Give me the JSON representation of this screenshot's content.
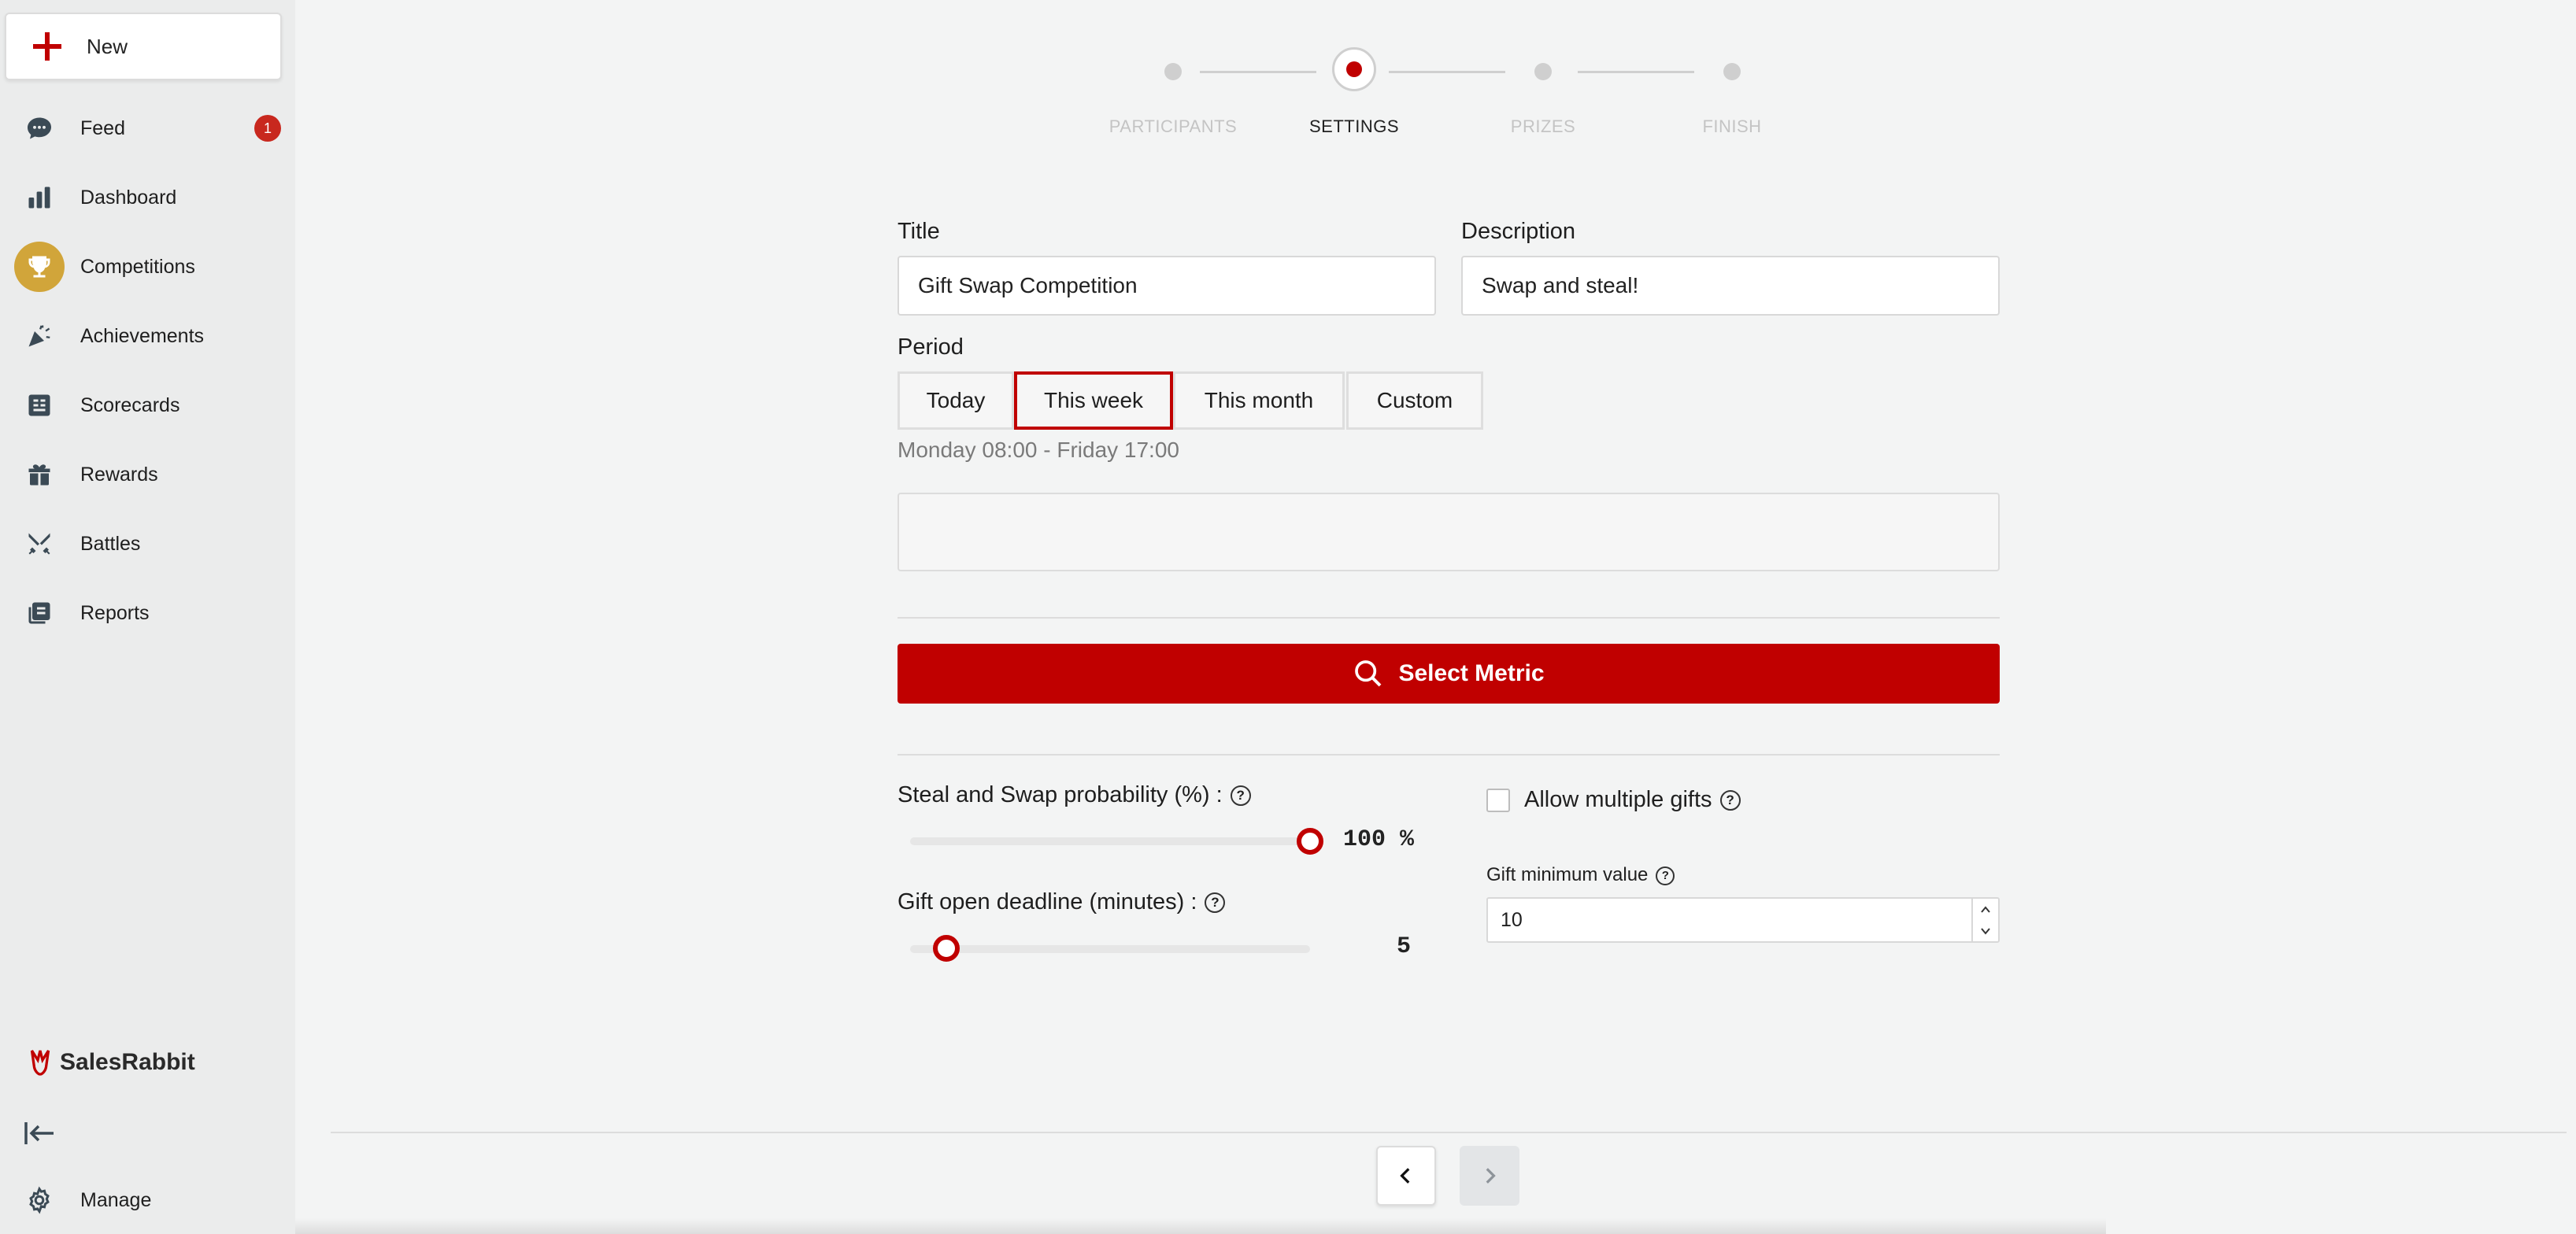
{
  "sidebar": {
    "new_label": "New",
    "items": [
      {
        "label": "Feed",
        "icon": "chat-icon",
        "badge": "1"
      },
      {
        "label": "Dashboard",
        "icon": "bar-chart-icon"
      },
      {
        "label": "Competitions",
        "icon": "trophy-icon",
        "active": true
      },
      {
        "label": "Achievements",
        "icon": "party-popper-icon"
      },
      {
        "label": "Scorecards",
        "icon": "scorecard-icon"
      },
      {
        "label": "Rewards",
        "icon": "gift-icon"
      },
      {
        "label": "Battles",
        "icon": "crossed-swords-icon"
      },
      {
        "label": "Reports",
        "icon": "reports-icon"
      }
    ],
    "brand": "SalesRabbit",
    "manage_label": "Manage"
  },
  "stepper": {
    "steps": [
      "PARTICIPANTS",
      "SETTINGS",
      "PRIZES",
      "FINISH"
    ],
    "current_index": 1
  },
  "form": {
    "title_label": "Title",
    "title_value": "Gift Swap Competition",
    "description_label": "Description",
    "description_value": "Swap and steal!",
    "period_label": "Period",
    "period_options": [
      "Today",
      "This week",
      "This month",
      "Custom"
    ],
    "period_selected": "This week",
    "period_range": "Monday 08:00 - Friday 17:00",
    "select_metric_label": "Select Metric",
    "steal_swap_label": "Steal and Swap probability (%) :",
    "steal_swap_value": "100 %",
    "steal_swap_level": 1.0,
    "gift_deadline_label": "Gift open deadline (minutes) :",
    "gift_deadline_value": "5",
    "gift_deadline_level": 0.09,
    "allow_multiple_label": "Allow multiple gifts",
    "allow_multiple_checked": false,
    "gift_min_label": "Gift minimum value",
    "gift_min_value": "10"
  },
  "colors": {
    "accent": "#c00000",
    "active_nav": "#d1a53a",
    "badge": "#c8281e"
  }
}
